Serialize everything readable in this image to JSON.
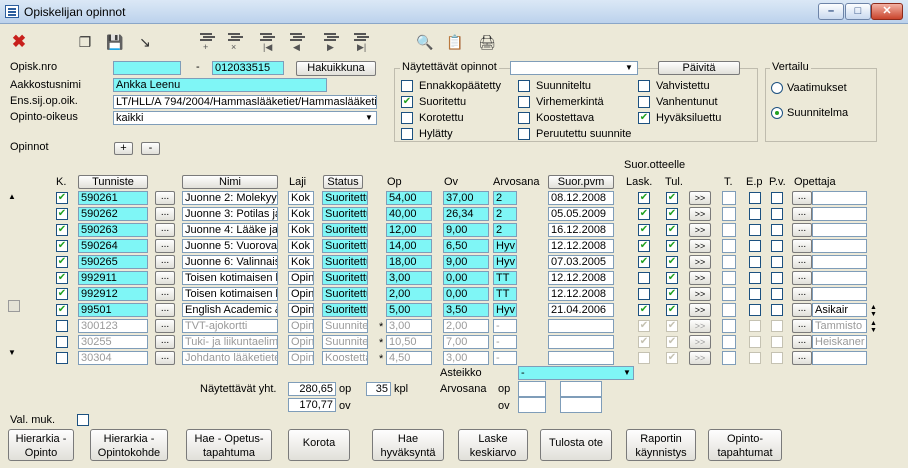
{
  "window": {
    "title": "Opiskelijan opinnot"
  },
  "toolbar": {
    "tools": [
      "delete",
      "copy",
      "save",
      "export",
      "add-row",
      "delete-row",
      "first",
      "previous",
      "next",
      "last",
      "search",
      "copy-data",
      "print"
    ]
  },
  "header": {
    "opisk_nro_label": "Opisk.nro",
    "opisk_nro_value": "",
    "opisk_nro_dash": "-",
    "opisk_nro_value2": "012033515",
    "hakuikkuna": "Hakuikkuna",
    "aakkostusnimi_label": "Aakkostusnimi",
    "aakkostusnimi_value": "Ankka Leenu",
    "ens_label": "Ens.sij.op.oik.",
    "ens_value": "LT/HLL/A 794/2004/Hammaslääketiet/Hammaslääketie",
    "opinto_oikeus_label": "Opinto-oikeus",
    "opinto_oikeus_value": "kaikki"
  },
  "shown": {
    "label": "Näytettävät opinnot",
    "select_value": "",
    "paivita": "Päivitä",
    "items": [
      {
        "label": "Ennakkopäätetty",
        "checked": false
      },
      {
        "label": "Suoritettu",
        "checked": true
      },
      {
        "label": "Korotettu",
        "checked": false
      },
      {
        "label": "Hylätty",
        "checked": false
      },
      {
        "label": "Suunniteltu",
        "checked": false
      },
      {
        "label": "Virhemerkintä",
        "checked": false
      },
      {
        "label": "Koostettava",
        "checked": false
      },
      {
        "label": "Peruutettu suunnite",
        "checked": false
      },
      {
        "label": "Vahvistettu",
        "checked": false
      },
      {
        "label": "Vanhentunut",
        "checked": false
      },
      {
        "label": "Hyväksiluettu",
        "checked": true
      }
    ]
  },
  "compare": {
    "label": "Vertailu",
    "options": [
      {
        "label": "Vaatimukset",
        "selected": false
      },
      {
        "label": "Suunnitelma",
        "selected": true
      }
    ]
  },
  "opinnot": {
    "label": "Opinnot",
    "plus": "+",
    "minus": "-"
  },
  "columns": {
    "k": "K.",
    "tunniste": "Tunniste",
    "nimi": "Nimi",
    "laji": "Laji",
    "status": "Status",
    "op": "Op",
    "ov": "Ov",
    "arvosana": "Arvosana",
    "suor_pvm": "Suor.pvm",
    "suor_otteelle": "Suor.otteelle",
    "lask": "Lask.",
    "tul": "Tul.",
    "t": "T.",
    "ep": "E.p",
    "pv": "P.v.",
    "opettaja": "Opettaja"
  },
  "rows": [
    {
      "k": true,
      "tunniste": "590261",
      "nimi": "Juonne 2: Molekyyl",
      "laji": "Kok",
      "status": "Suoritettu",
      "mark": "",
      "op": "54,00",
      "ov": "37,00",
      "arvosana": "2",
      "pvm": "08.12.2008",
      "lask": true,
      "tul": true,
      "teacher": "",
      "active": true
    },
    {
      "k": true,
      "tunniste": "590262",
      "nimi": "Juonne 3: Potilas ja",
      "laji": "Kok",
      "status": "Suoritettu",
      "mark": "",
      "op": "40,00",
      "ov": "26,34",
      "arvosana": "2",
      "pvm": "05.05.2009",
      "lask": true,
      "tul": true,
      "teacher": "",
      "active": true
    },
    {
      "k": true,
      "tunniste": "590263",
      "nimi": "Juonne 4: Lääke ja",
      "laji": "Kok",
      "status": "Suoritettu",
      "mark": "",
      "op": "12,00",
      "ov": "9,00",
      "arvosana": "2",
      "pvm": "16.12.2008",
      "lask": true,
      "tul": true,
      "teacher": "",
      "active": true
    },
    {
      "k": true,
      "tunniste": "590264",
      "nimi": "Juonne 5: Vuorovai",
      "laji": "Kok",
      "status": "Suoritettu",
      "mark": "",
      "op": "14,00",
      "ov": "6,50",
      "arvosana": "Hyv",
      "pvm": "12.12.2008",
      "lask": true,
      "tul": true,
      "teacher": "",
      "active": true
    },
    {
      "k": true,
      "tunniste": "590265",
      "nimi": "Juonne 6: Valinnais",
      "laji": "Kok",
      "status": "Suoritettu",
      "mark": "",
      "op": "18,00",
      "ov": "9,00",
      "arvosana": "Hyv",
      "pvm": "07.03.2005",
      "lask": true,
      "tul": true,
      "teacher": "",
      "active": true
    },
    {
      "k": true,
      "tunniste": "992911",
      "nimi": "Toisen kotimaisen k",
      "laji": "Opin",
      "status": "Suoritettu",
      "mark": "",
      "op": "3,00",
      "ov": "0,00",
      "arvosana": "TT",
      "pvm": "12.12.2008",
      "lask": false,
      "tul": true,
      "teacher": "",
      "active": true
    },
    {
      "k": true,
      "tunniste": "992912",
      "nimi": "Toisen kotimaisen k",
      "laji": "Opin",
      "status": "Suoritettu",
      "mark": "",
      "op": "2,00",
      "ov": "0,00",
      "arvosana": "TT",
      "pvm": "12.12.2008",
      "lask": false,
      "tul": true,
      "teacher": "",
      "active": true
    },
    {
      "k": true,
      "tunniste": "99501",
      "nimi": "English Academic &",
      "laji": "Opin",
      "status": "Suoritettu",
      "mark": "",
      "op": "5,00",
      "ov": "3,50",
      "arvosana": "Hyv",
      "pvm": "21.04.2006",
      "lask": true,
      "tul": true,
      "teacher": "Asikair",
      "active": true
    },
    {
      "k": false,
      "tunniste": "300123",
      "nimi": "TVT-ajokortti",
      "laji": "Opin",
      "status": "Suunnitel",
      "mark": "*",
      "op": "3,00",
      "ov": "2,00",
      "arvosana": "-",
      "pvm": "",
      "lask": true,
      "tul": true,
      "teacher": "Tammisto",
      "active": false
    },
    {
      "k": false,
      "tunniste": "30255",
      "nimi": "Tuki- ja liikuntaelimis",
      "laji": "Opin",
      "status": "Suunnitel",
      "mark": "*",
      "op": "10,50",
      "ov": "7,00",
      "arvosana": "-",
      "pvm": "",
      "lask": true,
      "tul": true,
      "teacher": "Heiskaner",
      "active": false
    },
    {
      "k": false,
      "tunniste": "30304",
      "nimi": "Johdanto lääketiete",
      "laji": "Opin",
      "status": "Koostetta",
      "mark": "*",
      "op": "4,50",
      "ov": "3,00",
      "arvosana": "-",
      "pvm": "",
      "lask": false,
      "tul": true,
      "teacher": "",
      "active": false
    }
  ],
  "row_buttons": {
    "dots": "...",
    "arrows": ">>"
  },
  "totals": {
    "asteikko_label": "Asteikko",
    "asteikko_value": "-",
    "naytettavat_label": "Näytettävät yht.",
    "op_value": "280,65",
    "op_unit": "op",
    "kpl_value": "35",
    "kpl_unit": "kpl",
    "ov_value": "170,77",
    "ov_unit": "ov",
    "arvosana_label": "Arvosana",
    "arv_op_label": "op",
    "arv_ov_label": "ov"
  },
  "val_muk": {
    "label": "Val. muk.",
    "checked": false
  },
  "bottom_buttons": [
    {
      "l1": "Hierarkia -",
      "l2": "Opinto"
    },
    {
      "l1": "Hierarkia -",
      "l2": "Opintokohde"
    },
    {
      "l1": "Hae - Opetus-",
      "l2": "tapahtuma"
    },
    {
      "l1": "Korota",
      "l2": ""
    },
    {
      "l1": "Hae",
      "l2": "hyväksyntä"
    },
    {
      "l1": "Laske",
      "l2": "keskiarvo"
    },
    {
      "l1": "Tulosta ote",
      "l2": ""
    },
    {
      "l1": "Raportin",
      "l2": "käynnistys"
    },
    {
      "l1": "Opinto-",
      "l2": "tapahtumat"
    }
  ]
}
